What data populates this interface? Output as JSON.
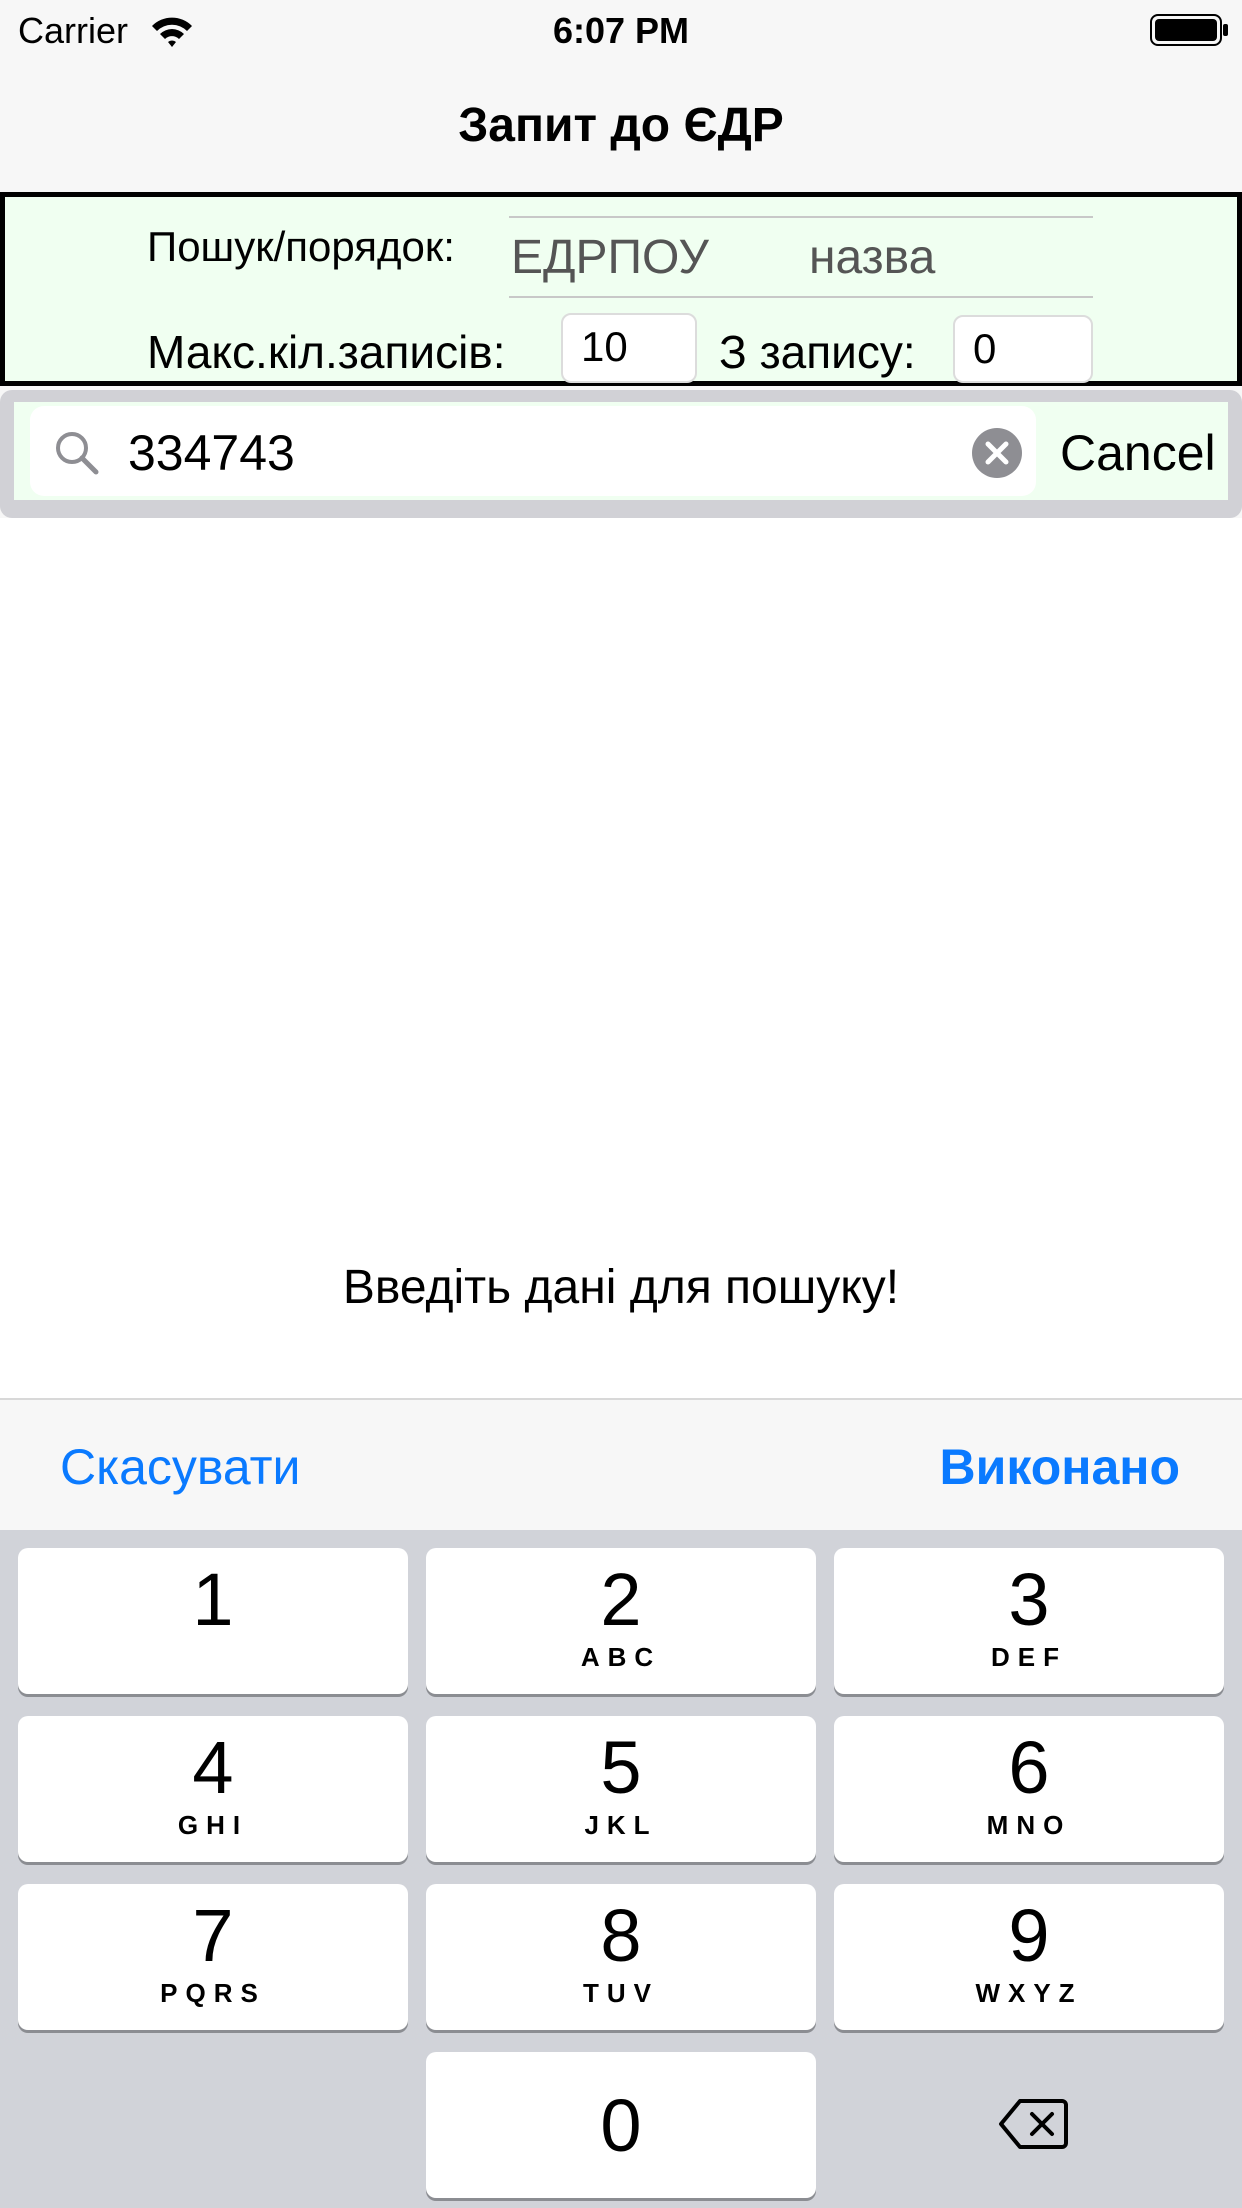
{
  "status_bar": {
    "carrier": "Carrier",
    "time": "6:07 PM"
  },
  "nav": {
    "title": "Запит до ЄДР"
  },
  "filters": {
    "order_label": "Пошук/порядок:",
    "segments": [
      "ЕДРПОУ",
      "назва"
    ],
    "max_label": "Макс.кіл.записів:",
    "max_value": "10",
    "from_label": "З запису:",
    "from_value": "0"
  },
  "search": {
    "value": "334743",
    "cancel_label": "Cancel"
  },
  "content": {
    "message": "Введіть дані для пошуку!"
  },
  "toolbar": {
    "cancel_label": "Скасувати",
    "done_label": "Виконано"
  },
  "keyboard": {
    "keys": [
      {
        "digit": "1",
        "letters": ""
      },
      {
        "digit": "2",
        "letters": "ABC"
      },
      {
        "digit": "3",
        "letters": "DEF"
      },
      {
        "digit": "4",
        "letters": "GHI"
      },
      {
        "digit": "5",
        "letters": "JKL"
      },
      {
        "digit": "6",
        "letters": "MNO"
      },
      {
        "digit": "7",
        "letters": "PQRS"
      },
      {
        "digit": "8",
        "letters": "TUV"
      },
      {
        "digit": "9",
        "letters": "WXYZ"
      },
      {
        "digit": "0",
        "letters": ""
      }
    ]
  },
  "colors": {
    "accent": "#0a7aff",
    "panel_bg": "#f0fff1",
    "keyboard_bg": "#d1d3d9"
  }
}
